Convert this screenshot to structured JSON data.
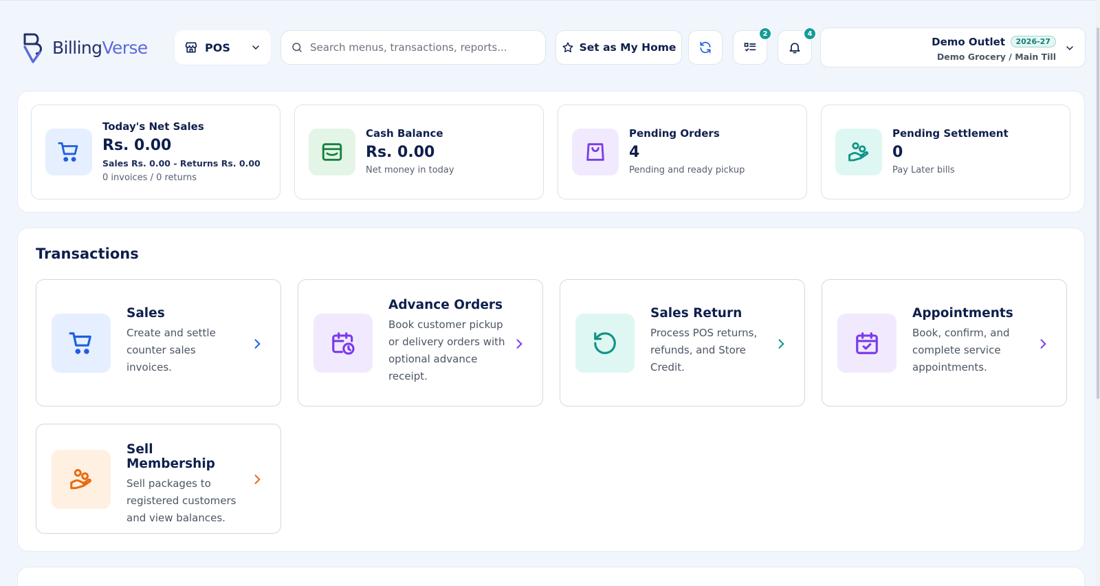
{
  "app": {
    "logo_prefix": "Billing",
    "logo_suffix": "Verse"
  },
  "header": {
    "module": "POS",
    "search_placeholder": "Search menus, transactions, reports...",
    "home_button": "Set as My Home",
    "tasks_badge": "2",
    "notifications_badge": "4",
    "outlet_name": "Demo Outlet",
    "financial_year": "2026-27",
    "outlet_sub": "Demo Grocery / Main Till"
  },
  "stats": [
    {
      "title": "Today's Net Sales",
      "value": "Rs. 0.00",
      "detail": "Sales Rs. 0.00 - Returns Rs. 0.00",
      "note": "0 invoices / 0 returns",
      "icon": "cart-icon"
    },
    {
      "title": "Cash Balance",
      "value": "Rs. 0.00",
      "note": "Net money in today",
      "icon": "wallet-icon"
    },
    {
      "title": "Pending Orders",
      "value": "4",
      "note": "Pending and ready pickup",
      "icon": "shopping-bag-icon"
    },
    {
      "title": "Pending Settlement",
      "value": "0",
      "note": "Pay Later bills",
      "icon": "hand-coins-icon"
    }
  ],
  "transactions": {
    "title": "Transactions",
    "cards": [
      {
        "title": "Sales",
        "description": "Create and settle counter sales invoices.",
        "icon": "cart-icon"
      },
      {
        "title": "Advance Orders",
        "description": "Book customer pickup or delivery orders with optional advance receipt.",
        "icon": "calendar-clock-icon"
      },
      {
        "title": "Sales Return",
        "description": "Process POS returns, refunds, and Store Credit.",
        "icon": "rotate-ccw-icon"
      },
      {
        "title": "Appointments",
        "description": "Book, confirm, and complete service appointments.",
        "icon": "calendar-check-icon"
      },
      {
        "title": "Sell Membership",
        "description": "Sell packages to registered customers and view balances.",
        "icon": "hand-coins-icon"
      }
    ]
  },
  "colors": {
    "blue": "#1f5fe0",
    "blue_bg": "#e6efff",
    "green": "#15803d",
    "green_bg": "#e3f5e6",
    "purple": "#7c3aed",
    "purple_bg": "#f1eafe",
    "teal": "#0f9488",
    "teal_bg": "#dff7f2",
    "orange": "#ea6a0c",
    "orange_bg": "#fff0e2",
    "badge": "#149c98"
  }
}
